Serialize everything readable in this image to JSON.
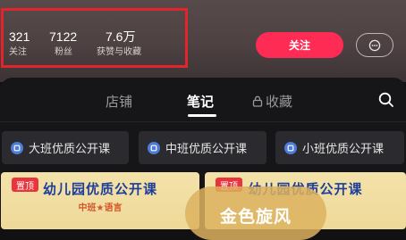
{
  "profile": {
    "stats": [
      {
        "value": "321",
        "label": "关注"
      },
      {
        "value": "7122",
        "label": "粉丝"
      },
      {
        "value": "7.6万",
        "label": "获赞与收藏"
      }
    ],
    "follow_label": "关注",
    "message_icon": "chat-bubble-icon"
  },
  "tabs": {
    "items": [
      {
        "label": "店铺",
        "active": false
      },
      {
        "label": "笔记",
        "active": true
      },
      {
        "label": "收藏",
        "active": false,
        "icon": "lock-icon"
      }
    ],
    "search_icon": "search-icon"
  },
  "collections": [
    {
      "label": "大班优质公开课"
    },
    {
      "label": "中班优质公开课"
    },
    {
      "label": "小班优质公开课"
    }
  ],
  "cards": [
    {
      "title": "幼儿园优质公开课",
      "subtitle": "中班★语言",
      "badge": "置顶"
    },
    {
      "title": "幼儿园优质公开课",
      "badge": "置顶"
    }
  ],
  "overlay": {
    "text": "金色旋风"
  },
  "colors": {
    "accent": "#fe2c55",
    "highlight_frame": "#e2242d",
    "card_title": "#1d3f9b",
    "chip_icon": "#4f7bd9"
  }
}
